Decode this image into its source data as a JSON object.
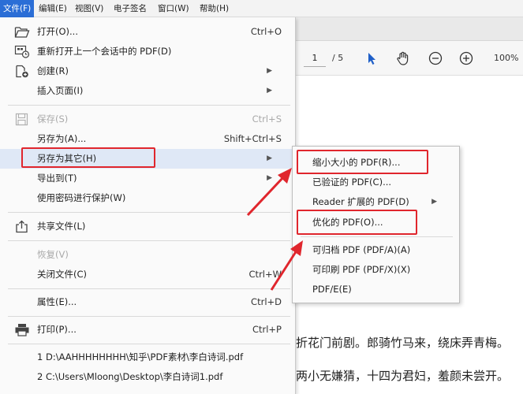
{
  "menubar": {
    "items": [
      "文件(F)",
      "编辑(E)",
      "视图(V)",
      "电子签名",
      "窗口(W)",
      "帮助(H)"
    ]
  },
  "toolbar": {
    "page_current": "1",
    "page_total": "/ 5",
    "zoom": "100%"
  },
  "file_menu": {
    "items": [
      {
        "label": "打开(O)...",
        "shortcut": "Ctrl+O",
        "icon": "folder-open-icon"
      },
      {
        "label": "重新打开上一个会话中的 PDF(D)",
        "shortcut": "",
        "icon": "reopen-session-icon"
      },
      {
        "label": "创建(R)",
        "shortcut": "",
        "icon": "create-pdf-icon",
        "submenu": true
      },
      {
        "label": "插入页面(I)",
        "shortcut": "",
        "submenu": true
      },
      {
        "label": "保存(S)",
        "shortcut": "Ctrl+S",
        "icon": "save-icon",
        "disabled": true
      },
      {
        "label": "另存为(A)...",
        "shortcut": "Shift+Ctrl+S"
      },
      {
        "label": "另存为其它(H)",
        "shortcut": "",
        "submenu": true
      },
      {
        "label": "导出到(T)",
        "shortcut": "",
        "submenu": true
      },
      {
        "label": "使用密码进行保护(W)",
        "shortcut": ""
      },
      {
        "label": "共享文件(L)",
        "shortcut": "",
        "icon": "share-icon"
      },
      {
        "label": "恢复(V)",
        "shortcut": "",
        "disabled": true
      },
      {
        "label": "关闭文件(C)",
        "shortcut": "Ctrl+W"
      },
      {
        "label": "属性(E)...",
        "shortcut": "Ctrl+D"
      },
      {
        "label": "打印(P)...",
        "shortcut": "Ctrl+P",
        "icon": "print-icon"
      },
      {
        "label": "1 D:\\AAHHHHHHHH\\知乎\\PDF素材\\李白诗词.pdf",
        "shortcut": ""
      },
      {
        "label": "2 C:\\Users\\Mloong\\Desktop\\李白诗词1.pdf",
        "shortcut": ""
      }
    ]
  },
  "submenu": {
    "items": [
      {
        "label": "缩小大小的 PDF(R)..."
      },
      {
        "label": "已验证的 PDF(C)..."
      },
      {
        "label": "Reader 扩展的 PDF(D)",
        "submenu": true
      },
      {
        "label": "优化的 PDF(O)..."
      },
      {
        "label": "可归档 PDF (PDF/A)(A)"
      },
      {
        "label": "可印刷 PDF (PDF/X)(X)"
      },
      {
        "label": "PDF/E(E)"
      }
    ]
  },
  "document": {
    "lines": [
      "折花门前剧。郎骑竹马来，绕床弄青梅。",
      "两小无嫌猜，十四为君妇，羞颜未尝开。"
    ]
  },
  "colors": {
    "menu_active": "#2b6ed6",
    "highlight_red": "#e0262d",
    "hover": "#dfe8f6"
  }
}
